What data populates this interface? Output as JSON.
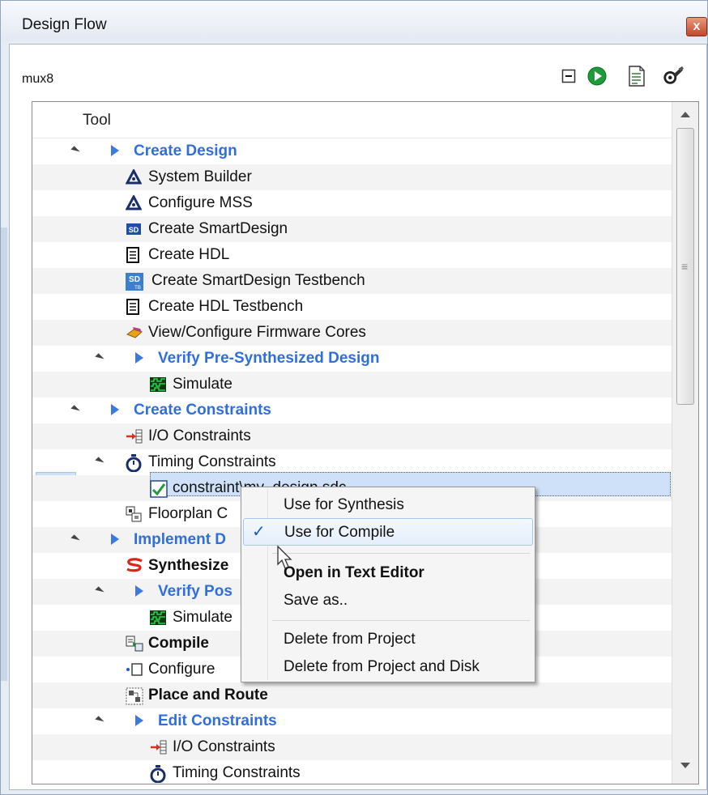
{
  "window": {
    "title": "Design Flow",
    "close_label": "x"
  },
  "project": {
    "name": "mux8"
  },
  "toolbar": {
    "icons": [
      "collapse-all-icon",
      "run-icon",
      "report-icon",
      "options-wrench-icon"
    ]
  },
  "tree": {
    "column_header": "Tool",
    "rows": [
      {
        "label": "Create Design",
        "type": "phase",
        "icon": "expand-triangle"
      },
      {
        "label": "System Builder",
        "type": "item",
        "icon": "system-builder-icon"
      },
      {
        "label": "Configure MSS",
        "type": "item",
        "icon": "system-builder-icon"
      },
      {
        "label": "Create SmartDesign",
        "type": "item",
        "icon": "smartdesign-icon"
      },
      {
        "label": "Create HDL",
        "type": "item",
        "icon": "document-icon"
      },
      {
        "label": "Create SmartDesign Testbench",
        "type": "item",
        "icon": "smartdesign-testbench-icon"
      },
      {
        "label": "Create HDL Testbench",
        "type": "item",
        "icon": "document-icon"
      },
      {
        "label": "View/Configure Firmware Cores",
        "type": "item",
        "icon": "firmware-icon"
      },
      {
        "label": "Verify Pre-Synthesized Design",
        "type": "phase",
        "icon": "expand-triangle"
      },
      {
        "label": "Simulate",
        "type": "item",
        "icon": "waveform-icon"
      },
      {
        "label": "Create Constraints",
        "type": "phase",
        "icon": "expand-triangle"
      },
      {
        "label": "I/O Constraints",
        "type": "item",
        "icon": "io-constraints-icon"
      },
      {
        "label": "Timing Constraints",
        "type": "item",
        "icon": "stopwatch-icon"
      },
      {
        "label": "constraint\\my_design.sdc",
        "type": "item",
        "icon": "sdc-file-icon"
      },
      {
        "label": "Floorplan C",
        "type": "item",
        "icon": "floorplan-icon"
      },
      {
        "label": "Implement D",
        "type": "phase",
        "icon": "expand-triangle"
      },
      {
        "label": "Synthesize",
        "type": "bold",
        "icon": "synthesize-icon"
      },
      {
        "label": "Verify Pos",
        "type": "phase",
        "icon": "expand-triangle"
      },
      {
        "label": "Simulate",
        "type": "item",
        "icon": "waveform-icon"
      },
      {
        "label": "Compile",
        "type": "bold",
        "icon": "compile-icon"
      },
      {
        "label": "Configure",
        "type": "item",
        "icon": "configure-icon"
      },
      {
        "label": "Place and Route",
        "type": "bold",
        "icon": "place-route-icon"
      },
      {
        "label": "Edit Constraints",
        "type": "phase",
        "icon": "expand-triangle"
      },
      {
        "label": "I/O Constraints",
        "type": "item",
        "icon": "io-constraints-icon"
      },
      {
        "label": "Timing Constraints",
        "type": "item",
        "icon": "stopwatch-icon"
      }
    ]
  },
  "context_menu": {
    "items": [
      {
        "label": "Use for Synthesis",
        "checked": false,
        "bold": false
      },
      {
        "label": "Use for Compile",
        "checked": true,
        "bold": false
      },
      {
        "label": "Open in Text Editor",
        "checked": false,
        "bold": true
      },
      {
        "label": "Save as..",
        "checked": false,
        "bold": false
      },
      {
        "label": "Delete from Project",
        "checked": false,
        "bold": false
      },
      {
        "label": "Delete from Project and Disk",
        "checked": false,
        "bold": false
      }
    ],
    "check_glyph": "✓"
  },
  "colors": {
    "phase_text": "#2f6fdc",
    "selection": "#cfe1f8"
  }
}
